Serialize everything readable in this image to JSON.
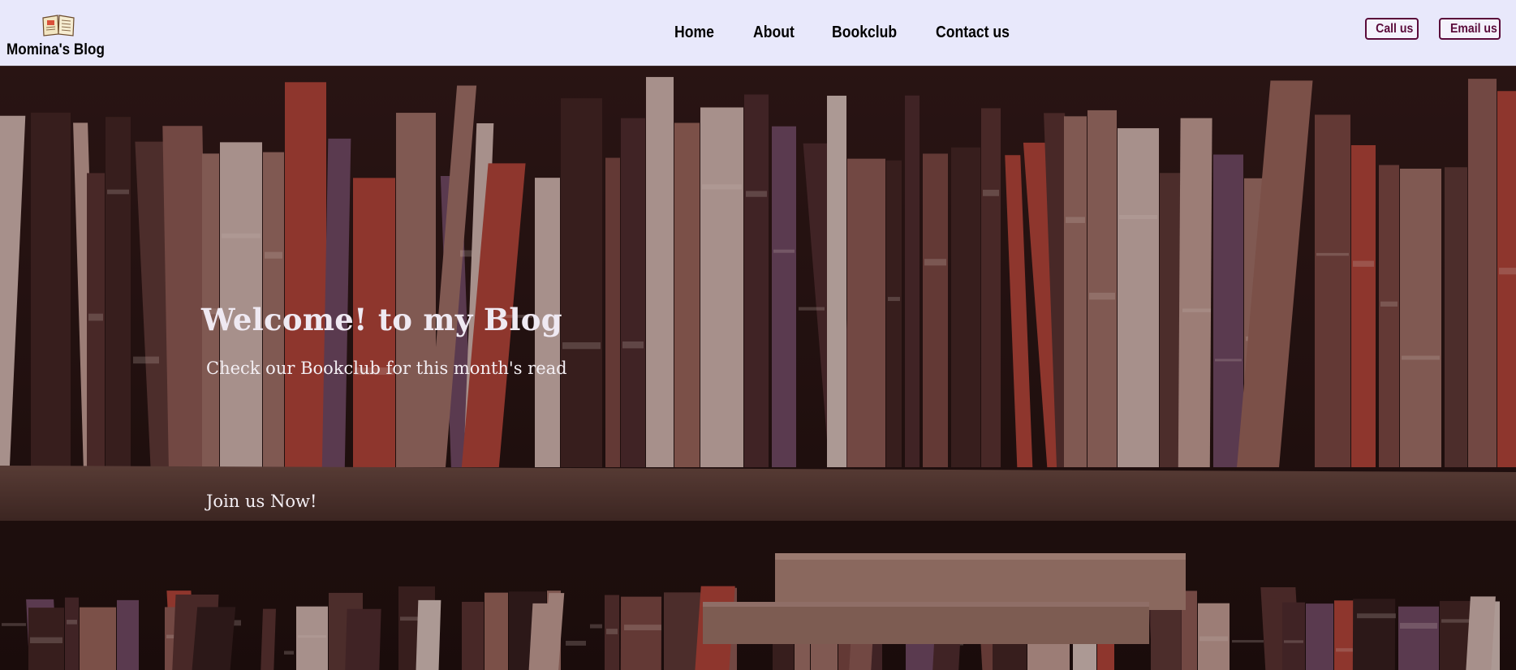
{
  "site": {
    "brand": "Momina's Blog",
    "logo_icon": "open-book-icon"
  },
  "nav": {
    "items": [
      {
        "label": "Home"
      },
      {
        "label": "About"
      },
      {
        "label": "Bookclub"
      },
      {
        "label": "Contact us"
      }
    ]
  },
  "contact": {
    "call_label": "Call us",
    "email_label": "Email us",
    "accent_color": "#5a0b3a"
  },
  "hero": {
    "title": "Welcome! to my Blog",
    "subtitle": "Check our Bookclub for this month's read",
    "cta": "Join us Now!",
    "background": "bookshelf-photo"
  },
  "colors": {
    "header_bg": "#e8e8fb",
    "hero_text": "#efe9f2"
  }
}
